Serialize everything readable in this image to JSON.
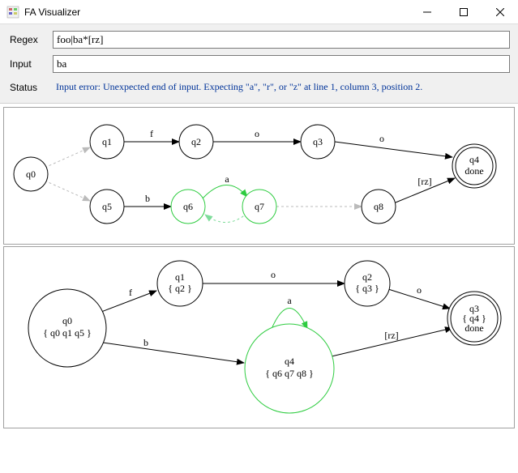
{
  "window": {
    "title": "FA Visualizer"
  },
  "form": {
    "regex_label": "Regex",
    "regex_value": "foo|ba*[rz]",
    "input_label": "Input",
    "input_value": "ba",
    "status_label": "Status",
    "status_value": "Input error: Unexpected end of input. Expecting \"a\", \"r\", or \"z\" at line 1, column 3, position 2."
  },
  "nfa": {
    "states": {
      "q0": "q0",
      "q1": "q1",
      "q2": "q2",
      "q3": "q3",
      "q4_line1": "q4",
      "q4_line2": "done",
      "q5": "q5",
      "q6": "q6",
      "q7": "q7",
      "q8": "q8"
    },
    "edges": {
      "f": "f",
      "o1": "o",
      "o2": "o",
      "b": "b",
      "a": "a",
      "rz": "[rz]"
    }
  },
  "dfa": {
    "states": {
      "q0_line1": "q0",
      "q0_line2": "{ q0  q1  q5 }",
      "q1_line1": "q1",
      "q1_line2": "{ q2 }",
      "q2_line1": "q2",
      "q2_line2": "{ q3 }",
      "q3_line1": "q3",
      "q3_line2": "{ q4 }",
      "q3_line3": "done",
      "q4_line1": "q4",
      "q4_line2": "{ q6  q7  q8 }"
    },
    "edges": {
      "f": "f",
      "o1": "o",
      "o2": "o",
      "b": "b",
      "a": "a",
      "rz": "[rz]"
    }
  }
}
